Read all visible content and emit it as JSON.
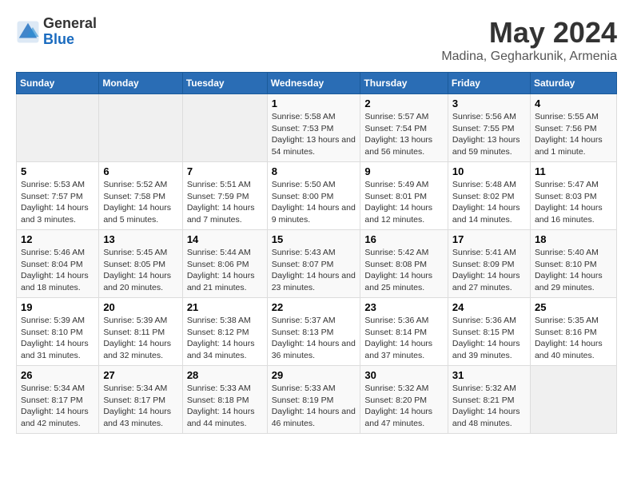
{
  "logo": {
    "general": "General",
    "blue": "Blue"
  },
  "header": {
    "title": "May 2024",
    "subtitle": "Madina, Gegharkunik, Armenia"
  },
  "days_of_week": [
    "Sunday",
    "Monday",
    "Tuesday",
    "Wednesday",
    "Thursday",
    "Friday",
    "Saturday"
  ],
  "weeks": [
    [
      {
        "day": "",
        "info": ""
      },
      {
        "day": "",
        "info": ""
      },
      {
        "day": "",
        "info": ""
      },
      {
        "day": "1",
        "info": "Sunrise: 5:58 AM\nSunset: 7:53 PM\nDaylight: 13 hours and 54 minutes."
      },
      {
        "day": "2",
        "info": "Sunrise: 5:57 AM\nSunset: 7:54 PM\nDaylight: 13 hours and 56 minutes."
      },
      {
        "day": "3",
        "info": "Sunrise: 5:56 AM\nSunset: 7:55 PM\nDaylight: 13 hours and 59 minutes."
      },
      {
        "day": "4",
        "info": "Sunrise: 5:55 AM\nSunset: 7:56 PM\nDaylight: 14 hours and 1 minute."
      }
    ],
    [
      {
        "day": "5",
        "info": "Sunrise: 5:53 AM\nSunset: 7:57 PM\nDaylight: 14 hours and 3 minutes."
      },
      {
        "day": "6",
        "info": "Sunrise: 5:52 AM\nSunset: 7:58 PM\nDaylight: 14 hours and 5 minutes."
      },
      {
        "day": "7",
        "info": "Sunrise: 5:51 AM\nSunset: 7:59 PM\nDaylight: 14 hours and 7 minutes."
      },
      {
        "day": "8",
        "info": "Sunrise: 5:50 AM\nSunset: 8:00 PM\nDaylight: 14 hours and 9 minutes."
      },
      {
        "day": "9",
        "info": "Sunrise: 5:49 AM\nSunset: 8:01 PM\nDaylight: 14 hours and 12 minutes."
      },
      {
        "day": "10",
        "info": "Sunrise: 5:48 AM\nSunset: 8:02 PM\nDaylight: 14 hours and 14 minutes."
      },
      {
        "day": "11",
        "info": "Sunrise: 5:47 AM\nSunset: 8:03 PM\nDaylight: 14 hours and 16 minutes."
      }
    ],
    [
      {
        "day": "12",
        "info": "Sunrise: 5:46 AM\nSunset: 8:04 PM\nDaylight: 14 hours and 18 minutes."
      },
      {
        "day": "13",
        "info": "Sunrise: 5:45 AM\nSunset: 8:05 PM\nDaylight: 14 hours and 20 minutes."
      },
      {
        "day": "14",
        "info": "Sunrise: 5:44 AM\nSunset: 8:06 PM\nDaylight: 14 hours and 21 minutes."
      },
      {
        "day": "15",
        "info": "Sunrise: 5:43 AM\nSunset: 8:07 PM\nDaylight: 14 hours and 23 minutes."
      },
      {
        "day": "16",
        "info": "Sunrise: 5:42 AM\nSunset: 8:08 PM\nDaylight: 14 hours and 25 minutes."
      },
      {
        "day": "17",
        "info": "Sunrise: 5:41 AM\nSunset: 8:09 PM\nDaylight: 14 hours and 27 minutes."
      },
      {
        "day": "18",
        "info": "Sunrise: 5:40 AM\nSunset: 8:10 PM\nDaylight: 14 hours and 29 minutes."
      }
    ],
    [
      {
        "day": "19",
        "info": "Sunrise: 5:39 AM\nSunset: 8:10 PM\nDaylight: 14 hours and 31 minutes."
      },
      {
        "day": "20",
        "info": "Sunrise: 5:39 AM\nSunset: 8:11 PM\nDaylight: 14 hours and 32 minutes."
      },
      {
        "day": "21",
        "info": "Sunrise: 5:38 AM\nSunset: 8:12 PM\nDaylight: 14 hours and 34 minutes."
      },
      {
        "day": "22",
        "info": "Sunrise: 5:37 AM\nSunset: 8:13 PM\nDaylight: 14 hours and 36 minutes."
      },
      {
        "day": "23",
        "info": "Sunrise: 5:36 AM\nSunset: 8:14 PM\nDaylight: 14 hours and 37 minutes."
      },
      {
        "day": "24",
        "info": "Sunrise: 5:36 AM\nSunset: 8:15 PM\nDaylight: 14 hours and 39 minutes."
      },
      {
        "day": "25",
        "info": "Sunrise: 5:35 AM\nSunset: 8:16 PM\nDaylight: 14 hours and 40 minutes."
      }
    ],
    [
      {
        "day": "26",
        "info": "Sunrise: 5:34 AM\nSunset: 8:17 PM\nDaylight: 14 hours and 42 minutes."
      },
      {
        "day": "27",
        "info": "Sunrise: 5:34 AM\nSunset: 8:17 PM\nDaylight: 14 hours and 43 minutes."
      },
      {
        "day": "28",
        "info": "Sunrise: 5:33 AM\nSunset: 8:18 PM\nDaylight: 14 hours and 44 minutes."
      },
      {
        "day": "29",
        "info": "Sunrise: 5:33 AM\nSunset: 8:19 PM\nDaylight: 14 hours and 46 minutes."
      },
      {
        "day": "30",
        "info": "Sunrise: 5:32 AM\nSunset: 8:20 PM\nDaylight: 14 hours and 47 minutes."
      },
      {
        "day": "31",
        "info": "Sunrise: 5:32 AM\nSunset: 8:21 PM\nDaylight: 14 hours and 48 minutes."
      },
      {
        "day": "",
        "info": ""
      }
    ]
  ]
}
